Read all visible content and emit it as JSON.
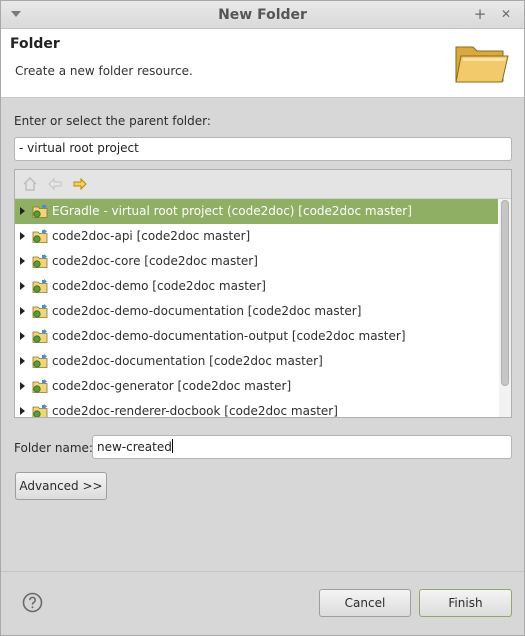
{
  "window": {
    "title": "New Folder",
    "minimize_glyph": "+",
    "close_glyph": "✕"
  },
  "header": {
    "title": "Folder",
    "subtitle": "Create a new folder resource.",
    "icon": "folder-open-icon"
  },
  "parent": {
    "label": "Enter or select the parent folder:",
    "value": "- virtual root project"
  },
  "tree_toolbar": {
    "icons": [
      "home-icon",
      "back-arrow-icon",
      "forward-arrow-icon"
    ]
  },
  "tree": {
    "items": [
      {
        "label": "EGradle - virtual root project (code2doc) [code2doc master]",
        "selected": true
      },
      {
        "label": "code2doc-api [code2doc master]",
        "selected": false
      },
      {
        "label": "code2doc-core [code2doc master]",
        "selected": false
      },
      {
        "label": "code2doc-demo [code2doc master]",
        "selected": false
      },
      {
        "label": "code2doc-demo-documentation [code2doc master]",
        "selected": false
      },
      {
        "label": "code2doc-demo-documentation-output [code2doc master]",
        "selected": false
      },
      {
        "label": "code2doc-documentation [code2doc master]",
        "selected": false
      },
      {
        "label": "code2doc-generator [code2doc master]",
        "selected": false
      },
      {
        "label": "code2doc-renderer-docbook [code2doc master]",
        "selected": false
      }
    ]
  },
  "folder_name": {
    "label": "Folder name:",
    "value": "new-created"
  },
  "buttons": {
    "advanced": "Advanced >>",
    "cancel": "Cancel",
    "finish": "Finish"
  },
  "colors": {
    "selection": "#8fb064",
    "folder_yellow": "#f2c96b"
  }
}
